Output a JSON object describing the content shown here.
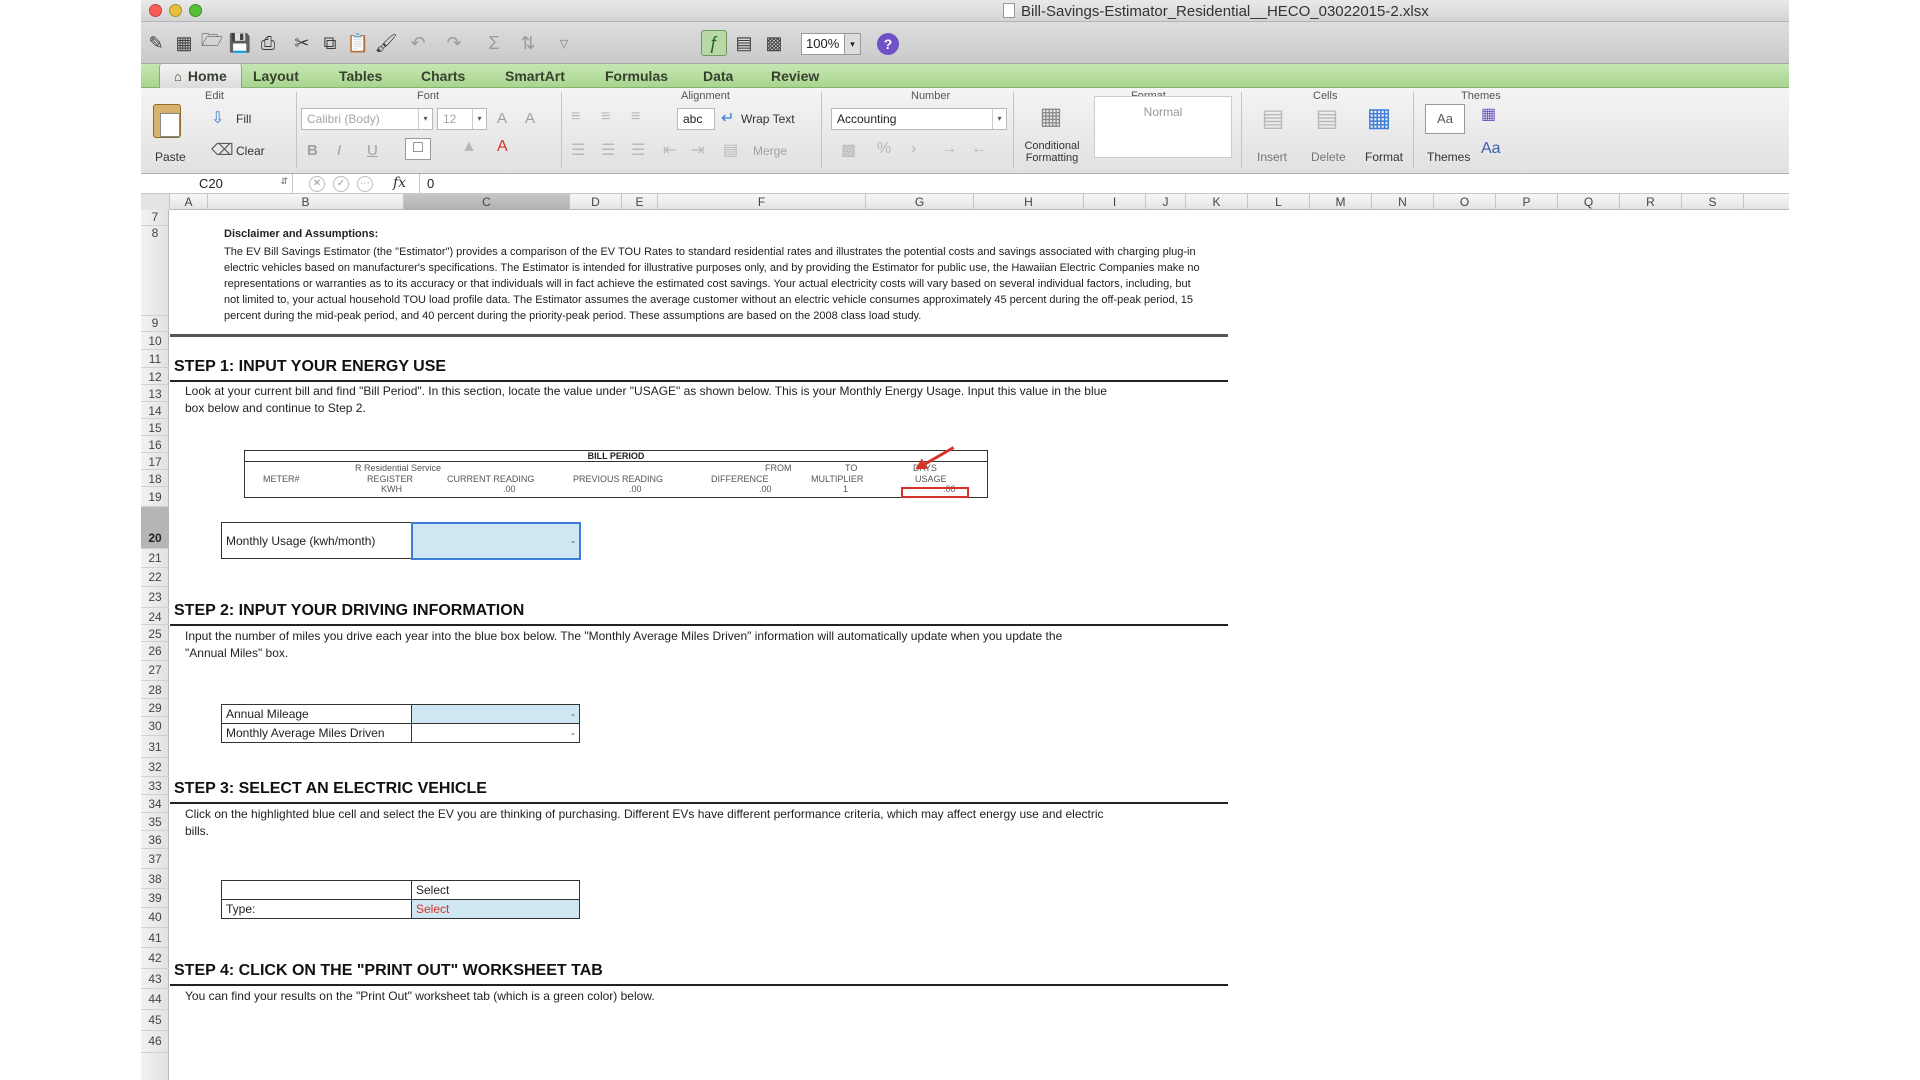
{
  "window": {
    "title": "Bill-Savings-Estimator_Residential__HECO_03022015-2.xlsx"
  },
  "toolbar": {
    "zoom": "100%",
    "help": "?"
  },
  "ribbon_tabs": [
    "Home",
    "Layout",
    "Tables",
    "Charts",
    "SmartArt",
    "Formulas",
    "Data",
    "Review"
  ],
  "ribbon": {
    "groups": {
      "edit": "Edit",
      "font": "Font",
      "alignment": "Alignment",
      "number": "Number",
      "format": "Format",
      "cells": "Cells",
      "themes": "Themes"
    },
    "paste": "Paste",
    "fill": "Fill",
    "clear": "Clear",
    "font_name": "Calibri (Body)",
    "font_size": "12",
    "wrap_text": "Wrap Text",
    "merge": "Merge",
    "abc": "abc",
    "number_format": "Accounting",
    "conditional_formatting": "Conditional Formatting",
    "style_normal": "Normal",
    "insert": "Insert",
    "delete": "Delete",
    "format_btn": "Format",
    "themes_btn": "Themes",
    "themes_aa": "Aa",
    "bold": "B",
    "italic": "I",
    "underline": "U",
    "grow_font": "A",
    "shrink_font": "A"
  },
  "formula_bar": {
    "cell_ref": "C20",
    "fx": "fx",
    "value": "0"
  },
  "columns": [
    "A",
    "B",
    "C",
    "D",
    "E",
    "F",
    "G",
    "H",
    "I",
    "J",
    "K",
    "L",
    "M",
    "N",
    "O",
    "P",
    "Q",
    "R",
    "S"
  ],
  "rows": [
    "7",
    "8",
    "9",
    "10",
    "11",
    "12",
    "13",
    "14",
    "15",
    "16",
    "17",
    "18",
    "19",
    "20",
    "21",
    "22",
    "23",
    "24",
    "25",
    "26",
    "27",
    "28",
    "29",
    "30",
    "31",
    "32",
    "33",
    "34",
    "35",
    "36",
    "37",
    "38",
    "39",
    "40",
    "41",
    "42",
    "43",
    "44",
    "45",
    "46"
  ],
  "sheet": {
    "disclaimer_title": "Disclaimer and Assumptions:",
    "disclaimer_lines": [
      "The EV Bill Savings Estimator (the \"Estimator\") provides a comparison of the EV TOU Rates to standard residential rates and illustrates the potential costs and savings associated with charging plug-in",
      "electric vehicles based on manufacturer's specifications.  The Estimator is intended for illustrative purposes only, and by providing the Estimator for public use, the Hawaiian Electric Companies make no",
      "representations or warranties as to its accuracy or that individuals will in fact achieve the estimated cost savings.  Your actual electricity costs will vary based on several individual factors, including, but",
      "not limited to, your actual household TOU load profile data.  The Estimator assumes the average customer without an electric vehicle consumes approximately 45 percent during the off-peak period, 15",
      "percent during the mid-peak period, and 40 percent during the priority-peak period.   These assumptions are based on the 2008 class load study."
    ],
    "step1": {
      "heading": "STEP 1:  INPUT YOUR ENERGY USE",
      "lines": [
        "Look at your current bill and find \"Bill Period\".  In this section, locate the value under \"USAGE\" as shown below.  This is your Monthly Energy Usage.  Input this value in the blue",
        "box below and continue to Step 2."
      ],
      "bill": {
        "header": "BILL PERIOD",
        "row1": [
          "R  Residential Service",
          "FROM",
          "TO",
          "DAYS"
        ],
        "row2": [
          "METER#",
          "REGISTER",
          "CURRENT READING",
          "PREVIOUS READING",
          "DIFFERENCE",
          "MULTIPLIER",
          "USAGE"
        ],
        "row3": [
          "KWH",
          ".00",
          ".00",
          ".00",
          "1",
          ".00"
        ]
      },
      "label": "Monthly Usage (kwh/month)",
      "value": "-"
    },
    "step2": {
      "heading": "STEP 2:  INPUT YOUR DRIVING INFORMATION",
      "lines": [
        "Input the number of miles you drive each year into the blue box below.  The \"Monthly Average Miles Driven\" information will automatically update when you update the",
        "\"Annual Miles\" box."
      ],
      "annual_label": "Annual Mileage",
      "annual_value": "-",
      "monthly_label": "Monthly Average Miles Driven",
      "monthly_value": "-"
    },
    "step3": {
      "heading": "STEP 3:  SELECT AN ELECTRIC VEHICLE",
      "lines": [
        "Click on the highlighted blue cell and select the EV you are thinking of purchasing.  Different EVs have different performance criteria, which may affect energy use and electric",
        "bills."
      ],
      "row1_value": "Select",
      "type_label": "Type:",
      "type_value": "Select"
    },
    "step4": {
      "heading": "STEP 4:  CLICK ON THE \"PRINT OUT\" WORKSHEET TAB",
      "line": "You can find your results on the \"Print Out\" worksheet tab (which is a green color) below."
    }
  },
  "colors": {
    "accent_green": "#a9d58f",
    "input_blue": "#cfe7f3",
    "highlight_red": "#d8322a",
    "selection": "#3b7dd8"
  }
}
